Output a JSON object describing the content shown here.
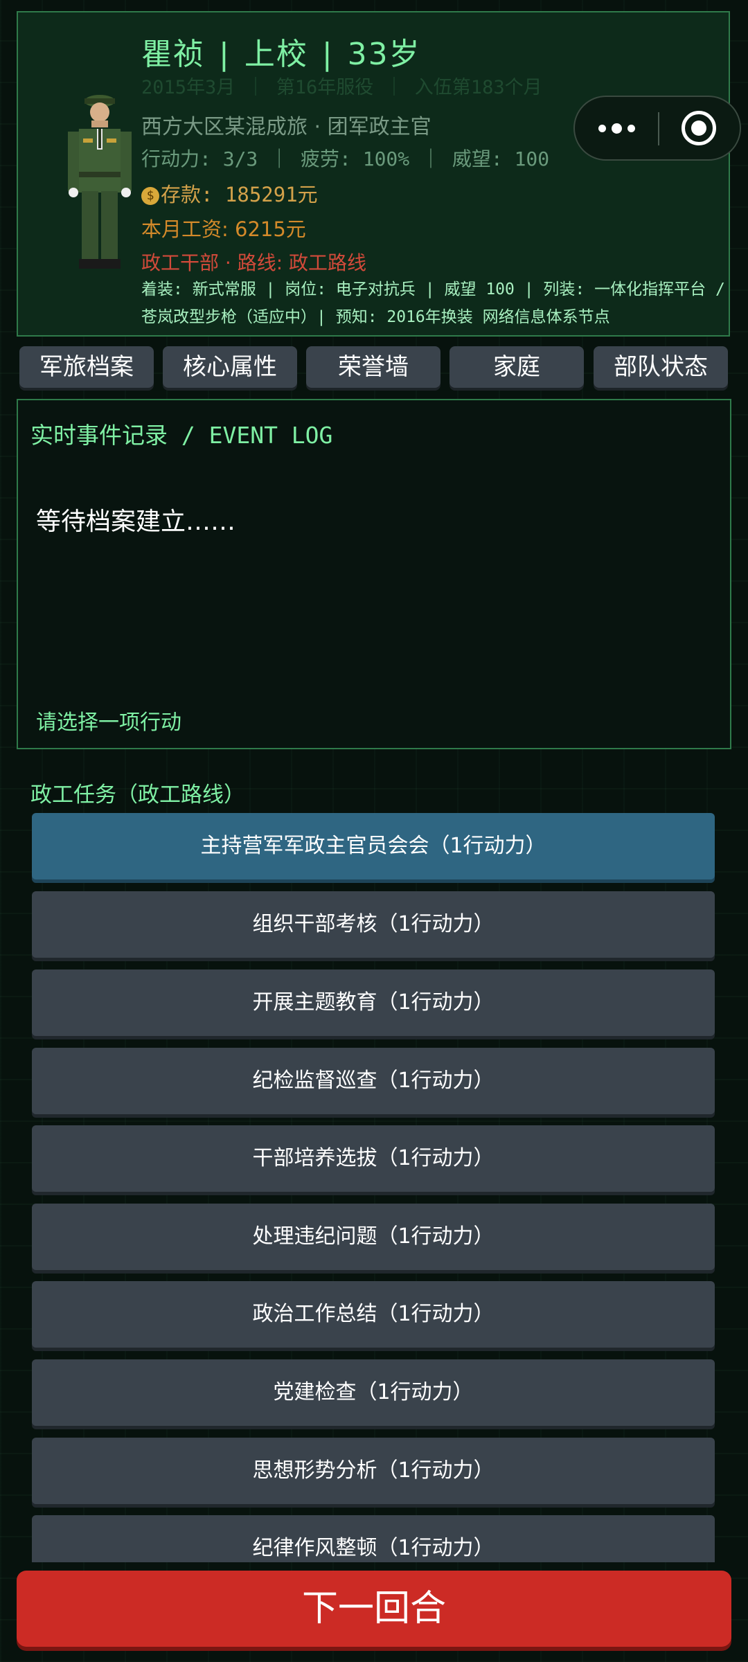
{
  "profile": {
    "name": "瞿祯",
    "rank": "上校",
    "age": "33岁",
    "date_line": "2015年3月 ｜ 第16年服役 ｜ 入伍第183个月",
    "unit_line": "西方大区某混成旅 · 团军政主官",
    "stats_line": "行动力: 3/3 ｜ 疲劳: 100% ｜ 威望: 100",
    "savings_line": "存款: 185291元",
    "salary_line": "本月工资: 6215元",
    "route_line": "政工干部 · 路线: 政工路线",
    "gear_line_1": "着装: 新式常服 | 岗位: 电子对抗兵 | 威望 100 | 列装: 一体化指挥平台 /",
    "gear_line_2": "苍岚改型步枪（适应中）| 预知: 2016年换装 网络信息体系节点",
    "avatar_icon": "soldier-avatar",
    "coin_icon": "money-bag-icon"
  },
  "capsule": {
    "menu_icon": "more-dots-icon",
    "close_icon": "target-close-icon"
  },
  "tabs": [
    "军旅档案",
    "核心属性",
    "荣誉墙",
    "家庭",
    "部队状态"
  ],
  "event_log": {
    "title": "实时事件记录 / EVENT LOG",
    "waiting_text": "等待档案建立……",
    "prompt": "请选择一项行动"
  },
  "section_title": "政工任务（政工路线）",
  "actions": [
    "主持营军军政主官员会会（1行动力）",
    "组织干部考核（1行动力）",
    "开展主题教育（1行动力）",
    "纪检监督巡查（1行动力）",
    "干部培养选拔（1行动力）",
    "处理违纪问题（1行动力）",
    "政治工作总结（1行动力）",
    "党建检查（1行动力）",
    "思想形势分析（1行动力）",
    "纪律作风整顿（1行动力）"
  ],
  "next_button": "下一回合",
  "colors": {
    "panel_border": "#2f7a4a",
    "accent_green": "#7ff0a4",
    "button_gray": "#3a434c",
    "button_active": "#2f6682",
    "next_red": "#cc2b25"
  }
}
